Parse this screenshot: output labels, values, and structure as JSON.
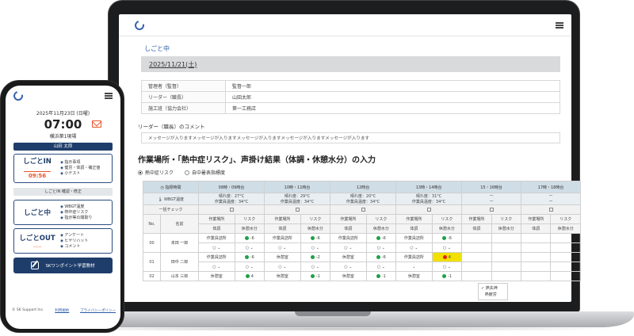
{
  "desktop": {
    "section_title": "しごと中",
    "date": "2025/11/21(土)",
    "info": [
      {
        "label": "管理者（監督）",
        "value": "監督一郎"
      },
      {
        "label": "リーダー（職長）",
        "value": "山田太郎"
      },
      {
        "label": "施工班（協力会社）",
        "value": "第一工務店"
      }
    ],
    "comment_title": "リーダー（職長）のコメント",
    "message": "メッセージが入りますメッセージが入りますメッセージが入りますメッセージが入りますメッセージが入ります",
    "main_title": "作業場所・「熱中症リスク」、声掛け結果（体調・休憩水分）の入力",
    "radio_1": "熱中症リスク",
    "radio_2": "自中暑表指標度",
    "row_labels": {
      "time": "指標時間",
      "wbgt": "WBGT温度",
      "check": "一括チェック",
      "no": "No.",
      "name": "名前"
    },
    "time_slots": [
      "08時・09時台",
      "10時・11時台",
      "12時台",
      "13時・14時台",
      "15・16時台",
      "17時・18時台"
    ],
    "wbgt": [
      {
        "l1": "晴れ度：27°C",
        "l2": "作業員温度：34°C"
      },
      {
        "l1": "晴れ度：29°C",
        "l2": "作業員温度：34°C"
      },
      {
        "l1": "晴れ度：20°C",
        "l2": "作業員温度：34°C"
      },
      {
        "l1": "晴れ度：31°C",
        "l2": "作業員温度：34°C"
      },
      {
        "l1": "ー",
        "l2": "ー"
      },
      {
        "l1": "ー",
        "l2": "ー"
      }
    ],
    "sub_heads": {
      "place": "作業場所",
      "risk": "リスク",
      "cond": "体調",
      "water": "休憩水分"
    },
    "workers": [
      {
        "no": "00",
        "name": "未田 一郎",
        "places": [
          "作業員詰所",
          "作業員詰所",
          "作業員詰所",
          "作業員詰所"
        ],
        "risks": [
          "-6",
          "-6",
          "-6",
          "-6"
        ]
      },
      {
        "no": "01",
        "name": "田中 二郎",
        "places": [
          "作業員詰所",
          "休憩室",
          "休憩室",
          "作業員詰所"
        ],
        "risks": [
          "-6",
          "-2",
          "-6",
          "4"
        ]
      },
      {
        "no": "02",
        "name": "山本 三郎",
        "places": [
          "休憩室",
          "休憩室",
          "休憩室",
          "休憩室"
        ],
        "risks": [
          "4",
          "-1",
          "-1",
          "-1"
        ]
      }
    ],
    "dropdown": [
      "熱失神",
      "熱疲労"
    ]
  },
  "phone": {
    "date": "2025年11月23日 (日曜)",
    "time": "07:00",
    "site": "横浜第1現場",
    "user": "山田 太郎",
    "in_title": "しごとIN",
    "in_time": "09:56",
    "in_items": [
      "指示事項",
      "健労・体調・補正値",
      "小テスト"
    ],
    "mid_bar": "しごとIN 確認・修正",
    "work_title": "しごと中",
    "work_items": [
      "WBGT温度",
      "熱中症リスク",
      "指示等の聞取り"
    ],
    "out_title": "しごとOUT",
    "out_time": "--:--",
    "out_items": [
      "アンケート",
      "ヒヤリハット",
      "コメント"
    ],
    "button": "SKワンポイント学習教材",
    "footer_left": "© SK Support Inc.",
    "footer_terms": "利用規約",
    "footer_privacy": "プライバシーポリシー"
  }
}
